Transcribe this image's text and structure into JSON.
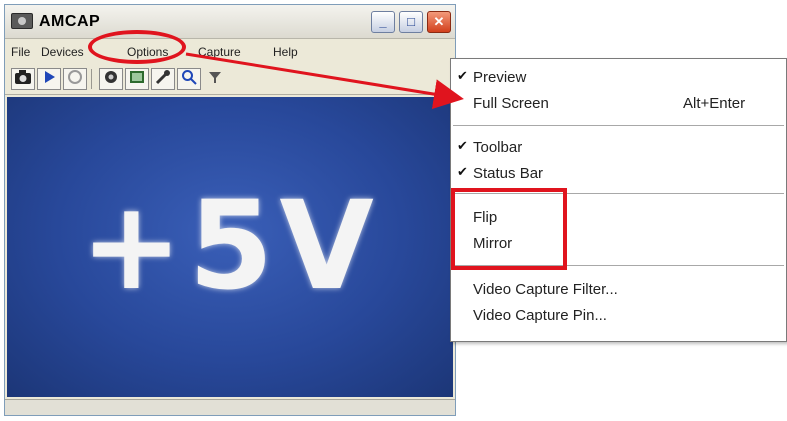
{
  "window": {
    "title": "AMCAP",
    "controls": {
      "minimize": "_",
      "maximize": "□",
      "close": "✕"
    }
  },
  "menubar": {
    "items": [
      {
        "label": "File"
      },
      {
        "label": "Devices"
      },
      {
        "label": "Options"
      },
      {
        "label": "Capture"
      },
      {
        "label": "Help"
      }
    ]
  },
  "toolbar": {
    "icons": [
      "camera-icon",
      "play-icon",
      "stop-icon",
      "settings-icon",
      "image-icon",
      "tools-icon",
      "zoom-icon",
      "filter-icon"
    ]
  },
  "video": {
    "text": "+5V"
  },
  "options_menu": {
    "items": [
      {
        "label": "Preview",
        "checked": true,
        "check": "✔"
      },
      {
        "label": "Full Screen",
        "shortcut": "Alt+Enter"
      },
      {
        "label": "Toolbar",
        "checked": true,
        "check": "✔"
      },
      {
        "label": "Status Bar",
        "checked": true,
        "check": "✔"
      },
      {
        "label": "Flip"
      },
      {
        "label": "Mirror"
      },
      {
        "label": "Video Capture Filter..."
      },
      {
        "label": "Video Capture Pin..."
      }
    ]
  },
  "annotation_color": "#e0141e"
}
